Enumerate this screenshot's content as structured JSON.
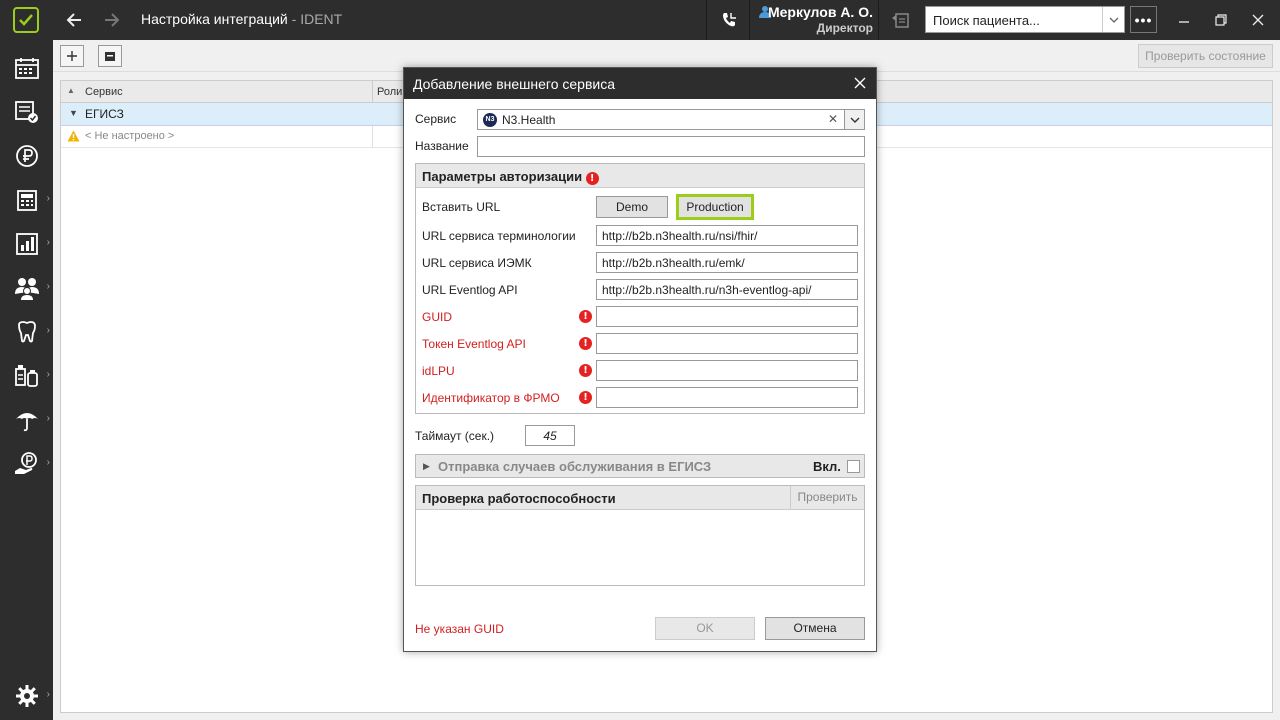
{
  "titlebar": {
    "title": "Настройка интеграций",
    "subtitle": " - IDENT",
    "user_name": "Меркулов А. О.",
    "user_role": "Директор",
    "search_placeholder": "Поиск пациента...",
    "more_label": "•••"
  },
  "toolbar": {
    "check_state_label": "Проверить состояние"
  },
  "grid": {
    "columns": [
      "Сервис",
      "Роли"
    ],
    "group_label": "ЕГИСЗ",
    "row_label": "< Не настроено >"
  },
  "dialog": {
    "title": "Добавление внешнего сервиса",
    "service_label": "Сервис",
    "service_value": "N3.Health",
    "service_icon_text": "N3",
    "name_label": "Название",
    "name_value": "",
    "auth_section_title": "Параметры авторизации",
    "insert_url_label": "Вставить URL",
    "demo_label": "Demo",
    "production_label": "Production",
    "fields": [
      {
        "label": "URL сервиса терминологии",
        "value": "http://b2b.n3health.ru/nsi/fhir/",
        "required": false
      },
      {
        "label": "URL сервиса ИЭМК",
        "value": "http://b2b.n3health.ru/emk/",
        "required": false
      },
      {
        "label": "URL Eventlog API",
        "value": "http://b2b.n3health.ru/n3h-eventlog-api/",
        "required": false
      },
      {
        "label": "GUID",
        "value": "",
        "required": true
      },
      {
        "label": "Токен Eventlog API",
        "value": "",
        "required": true
      },
      {
        "label": "idLPU",
        "value": "",
        "required": true
      },
      {
        "label": "Идентификатор в ФРМО",
        "value": "",
        "required": true
      }
    ],
    "timeout_label": "Таймаут (сек.)",
    "timeout_value": "45",
    "send_section_title": "Отправка случаев обслуживания в ЕГИСЗ",
    "enabled_label": "Вкл.",
    "health_section_title": "Проверка работоспособности",
    "check_button_label": "Проверить",
    "error_message": "Не указан GUID",
    "ok_label": "OK",
    "cancel_label": "Отмена"
  },
  "colors": {
    "accent_green": "#9ccd1a",
    "error_red": "#d32020",
    "dark_chrome": "#2d2d2d",
    "group_row_bg": "#dceef9"
  },
  "icons": [
    "logo-check-icon",
    "back-arrow-icon",
    "forward-arrow-icon",
    "phone-icon",
    "user-icon",
    "history-icon",
    "chevron-down-icon",
    "minimize-icon",
    "restore-icon",
    "close-icon",
    "calendar-icon",
    "schedule-check-icon",
    "ruble-icon",
    "cash-register-icon",
    "reports-icon",
    "patients-icon",
    "tooth-icon",
    "inventory-icon",
    "insurance-icon",
    "finance-icon",
    "settings-icon",
    "plus-icon",
    "archive-icon",
    "warning-icon"
  ]
}
